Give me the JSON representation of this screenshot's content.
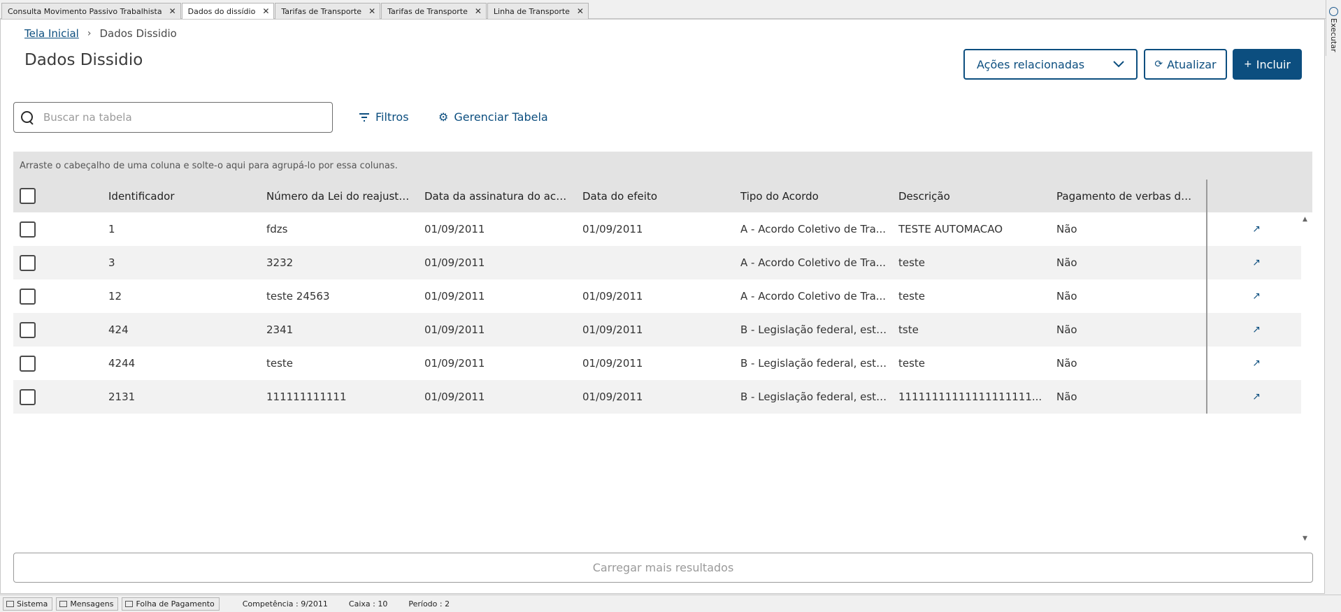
{
  "tabs": [
    {
      "label": "Consulta Movimento Passivo Trabalhista",
      "active": false
    },
    {
      "label": "Dados do dissídio",
      "active": true
    },
    {
      "label": "Tarifas de Transporte",
      "active": false
    },
    {
      "label": "Tarifas de Transporte",
      "active": false
    },
    {
      "label": "Linha de Transporte",
      "active": false
    }
  ],
  "side": {
    "execute_label": "Executar"
  },
  "breadcrumb": {
    "home": "Tela Inicial",
    "current": "Dados Dissidio"
  },
  "page_title": "Dados Dissidio",
  "actions": {
    "related": "Ações relacionadas",
    "update": "Atualizar",
    "include": "Incluir"
  },
  "search": {
    "placeholder": "Buscar na tabela"
  },
  "toolbar": {
    "filters": "Filtros",
    "manage": "Gerenciar Tabela"
  },
  "group_hint": "Arraste o cabeçalho de uma coluna e solte-o aqui para agrupá-lo por essa colunas.",
  "columns": [
    "Identificador",
    "Número da Lei do reajuste r...",
    "Data da assinatura do acor...",
    "Data do efeito",
    "Tipo do Acordo",
    "Descrição",
    "Pagamento de verbas devi..."
  ],
  "rows": [
    {
      "id": "1",
      "num": "fdzs",
      "date_sign": "01/09/2011",
      "date_effect": "01/09/2011",
      "tipo": "A - Acordo Coletivo de Tra...",
      "desc": "TESTE AUTOMACAO",
      "pag": "Não"
    },
    {
      "id": "3",
      "num": "3232",
      "date_sign": "01/09/2011",
      "date_effect": "",
      "tipo": "A - Acordo Coletivo de Tra...",
      "desc": "teste",
      "pag": "Não"
    },
    {
      "id": "12",
      "num": "teste 24563",
      "date_sign": "01/09/2011",
      "date_effect": "01/09/2011",
      "tipo": "A - Acordo Coletivo de Tra...",
      "desc": "teste",
      "pag": "Não"
    },
    {
      "id": "424",
      "num": "2341",
      "date_sign": "01/09/2011",
      "date_effect": "01/09/2011",
      "tipo": "B - Legislação federal, esta...",
      "desc": "tste",
      "pag": "Não"
    },
    {
      "id": "4244",
      "num": "teste",
      "date_sign": "01/09/2011",
      "date_effect": "01/09/2011",
      "tipo": "B - Legislação federal, esta...",
      "desc": "teste",
      "pag": "Não"
    },
    {
      "id": "2131",
      "num": "111111111111",
      "date_sign": "01/09/2011",
      "date_effect": "01/09/2011",
      "tipo": "B - Legislação federal, esta...",
      "desc": "11111111111111111111...",
      "pag": "Não"
    }
  ],
  "load_more": "Carregar mais resultados",
  "statusbar": {
    "sistema": "Sistema",
    "mensagens": "Mensagens",
    "folha": "Folha de Pagamento",
    "competencia": "Competência : 9/2011",
    "caixa": "Caixa : 10",
    "periodo": "Período : 2"
  }
}
